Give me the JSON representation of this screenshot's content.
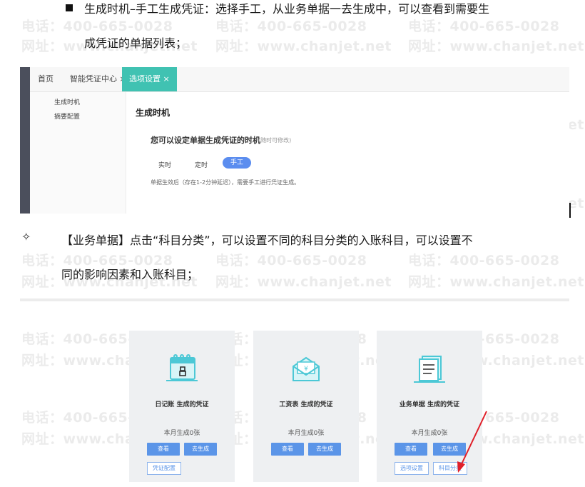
{
  "watermark": {
    "phone": "电话：400-665-0028",
    "url": "网址：www.chanjet.net"
  },
  "doc": {
    "para1_line1": "生成时机–手工生成凭证：选择手工，从业务单据一去生成中，可以查看到需要生",
    "para1_line2": "成凭证的单据列表；",
    "para2_bullet": "✧",
    "para2_line1": "【业务单据】点击“科目分类”，可以设置不同的科目分类的入账科目，可以设置不",
    "para2_line2": "同的影响因素和入账科目；"
  },
  "screen1": {
    "tabs": [
      "首页",
      "智能凭证中心 ×",
      "选项设置 ×"
    ],
    "side_items": [
      "生成时机",
      "摘要配置"
    ],
    "title": "生成时机",
    "subtitle": "您可以设定单据生成凭证的时机",
    "subtitle_note": "(随时可修改)",
    "options": [
      "实时",
      "定时",
      "手工"
    ],
    "desc": "单据生效后（存在1-2分钟延迟），需要手工进行凭证生成。"
  },
  "cards": [
    {
      "title": "日记账 生成的凭证",
      "count": "本月生成0张",
      "btn_view": "查看",
      "btn_gen": "去生成",
      "extra_buttons": [
        "凭证配置"
      ]
    },
    {
      "title": "工资表 生成的凭证",
      "count": "本月生成0张",
      "btn_view": "查看",
      "btn_gen": "去生成",
      "extra_buttons": []
    },
    {
      "title": "业务单据 生成的凭证",
      "count": "本月生成0张",
      "btn_view": "查看",
      "btn_gen": "去生成",
      "extra_buttons": [
        "选项设置",
        "科目分类"
      ]
    }
  ],
  "colors": {
    "accent_teal": "#40c2b2",
    "button_blue": "#5b95e8",
    "icon_teal": "#4cc8d6",
    "arrow_red": "#e0202a"
  }
}
